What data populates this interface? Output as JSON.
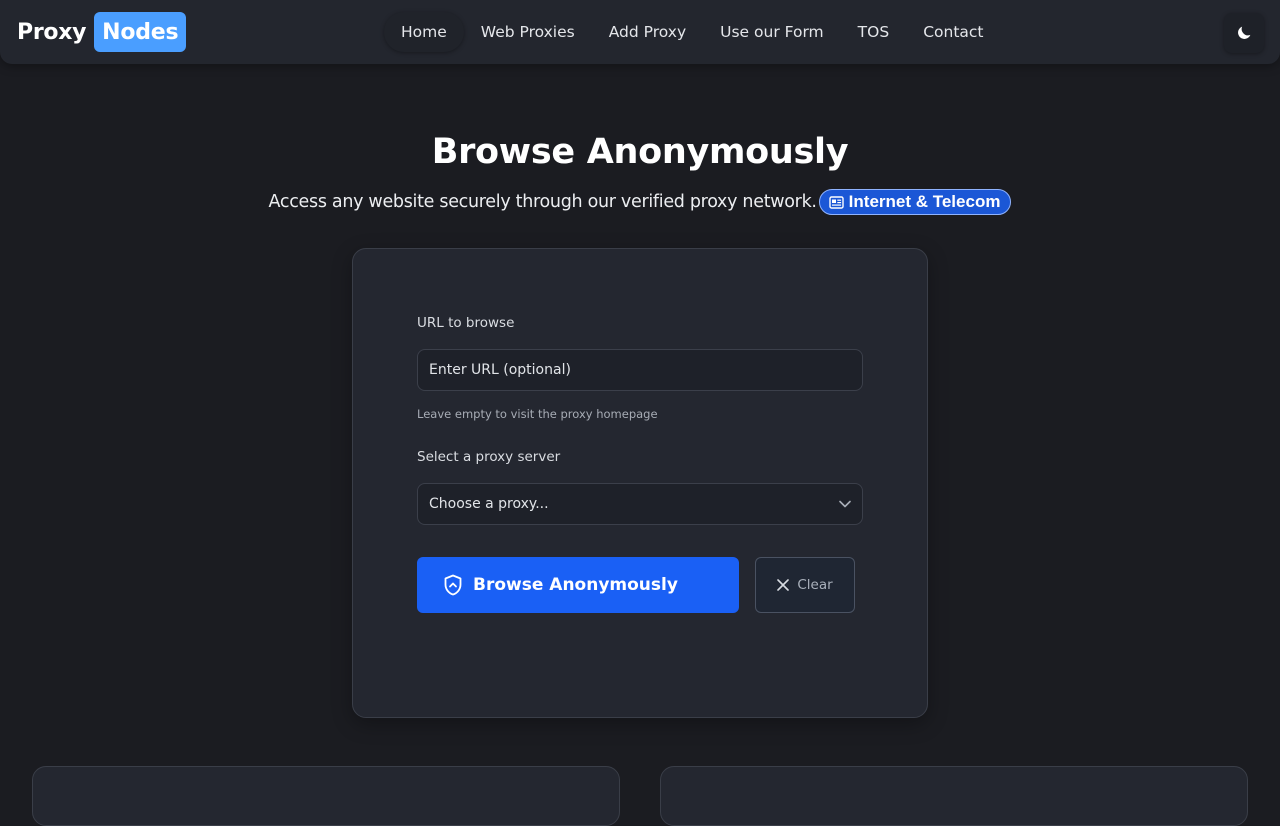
{
  "brand": {
    "part1": "Proxy",
    "part2": "Nodes",
    "accent": "#4a9eff"
  },
  "nav": {
    "items": [
      {
        "label": "Home",
        "active": true
      },
      {
        "label": "Web Proxies"
      },
      {
        "label": "Add Proxy"
      },
      {
        "label": "Use our Form"
      },
      {
        "label": "TOS"
      },
      {
        "label": "Contact"
      }
    ],
    "theme_icon": "moon-icon"
  },
  "hero": {
    "title": "Browse Anonymously",
    "subtitle": "Access any website securely through our verified proxy network.",
    "badge": {
      "icon": "newspaper-icon",
      "label": "Internet & Telecom",
      "color": "#1b57d6"
    }
  },
  "form": {
    "url_label": "URL to browse",
    "url_placeholder": "Enter URL (optional)",
    "url_help": "Leave empty to visit the proxy homepage",
    "proxy_label": "Select a proxy server",
    "proxy_selected": "Choose a proxy...",
    "submit_label": "Browse Anonymously",
    "submit_icon": "shield-icon",
    "submit_color": "#1a60f5",
    "clear_label": "Clear",
    "clear_icon": "close-icon"
  }
}
